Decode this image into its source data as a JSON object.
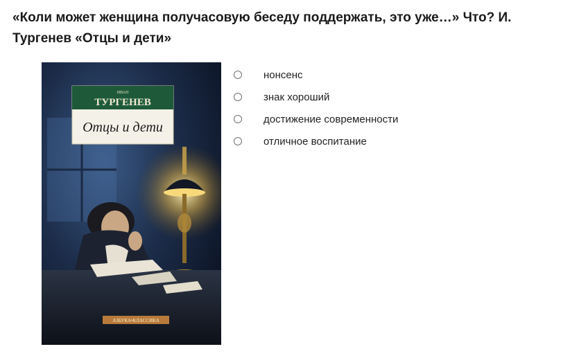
{
  "question": {
    "line1": "«Коли может женщина получасовую беседу поддержать, это уже…» Что? И.",
    "line2": "Тургенев «Отцы и дети»"
  },
  "cover": {
    "author_small": "ИВАН",
    "author": "ТУРГЕНЕВ",
    "title": "Отцы и дети",
    "series": "АЗБУКА•КЛАССИКА"
  },
  "options": [
    {
      "label": "нонсенс"
    },
    {
      "label": "знак хороший"
    },
    {
      "label": "достижение современности"
    },
    {
      "label": "отличное воспитание"
    }
  ]
}
